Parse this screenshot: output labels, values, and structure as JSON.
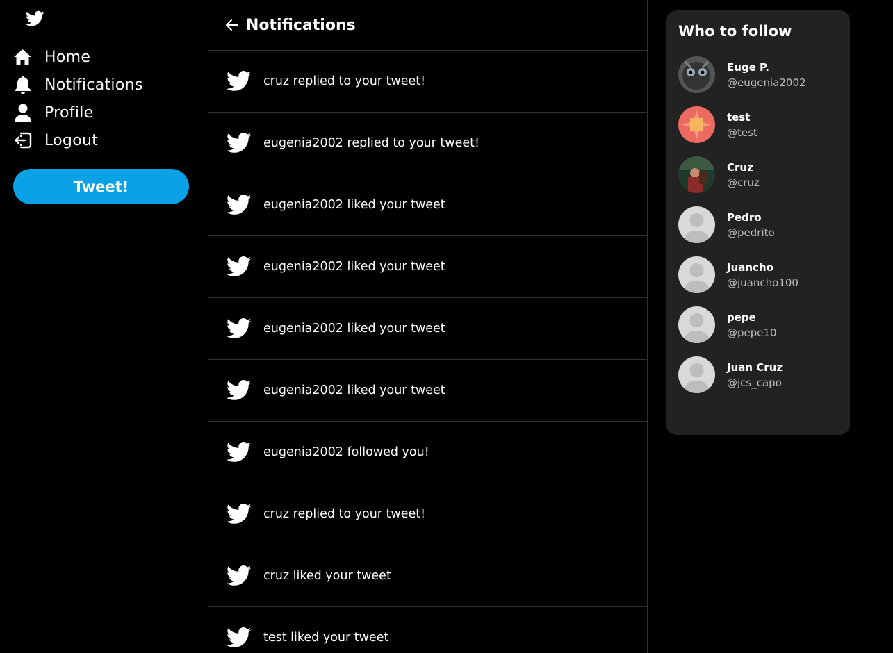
{
  "sidebar": {
    "logo_icon": "twitter-bird-icon",
    "nav": [
      {
        "label": "Home",
        "icon": "home-icon"
      },
      {
        "label": "Notifications",
        "icon": "bell-icon"
      },
      {
        "label": "Profile",
        "icon": "user-icon"
      },
      {
        "label": "Logout",
        "icon": "logout-icon"
      }
    ],
    "tweet_button": "Tweet!"
  },
  "main": {
    "title": "Notifications",
    "notifications": [
      "cruz replied to your tweet!",
      "eugenia2002 replied to your tweet!",
      "eugenia2002 liked your tweet",
      "eugenia2002 liked your tweet",
      "eugenia2002 liked your tweet",
      "eugenia2002 liked your tweet",
      "eugenia2002 followed you!",
      "cruz replied to your tweet!",
      "cruz liked your tweet",
      "test liked your tweet"
    ]
  },
  "who_to_follow": {
    "title": "Who to follow",
    "users": [
      {
        "name": "Euge P.",
        "handle": "@eugenia2002"
      },
      {
        "name": "test",
        "handle": "@test"
      },
      {
        "name": "Cruz",
        "handle": "@cruz"
      },
      {
        "name": "Pedro",
        "handle": "@pedrito"
      },
      {
        "name": "Juancho",
        "handle": "@juancho100"
      },
      {
        "name": "pepe",
        "handle": "@pepe10"
      },
      {
        "name": "Juan Cruz",
        "handle": "@jcs_capo"
      }
    ]
  },
  "colors": {
    "accent": "#0aa1e6",
    "panel": "#222222",
    "border": "#2f3336"
  }
}
